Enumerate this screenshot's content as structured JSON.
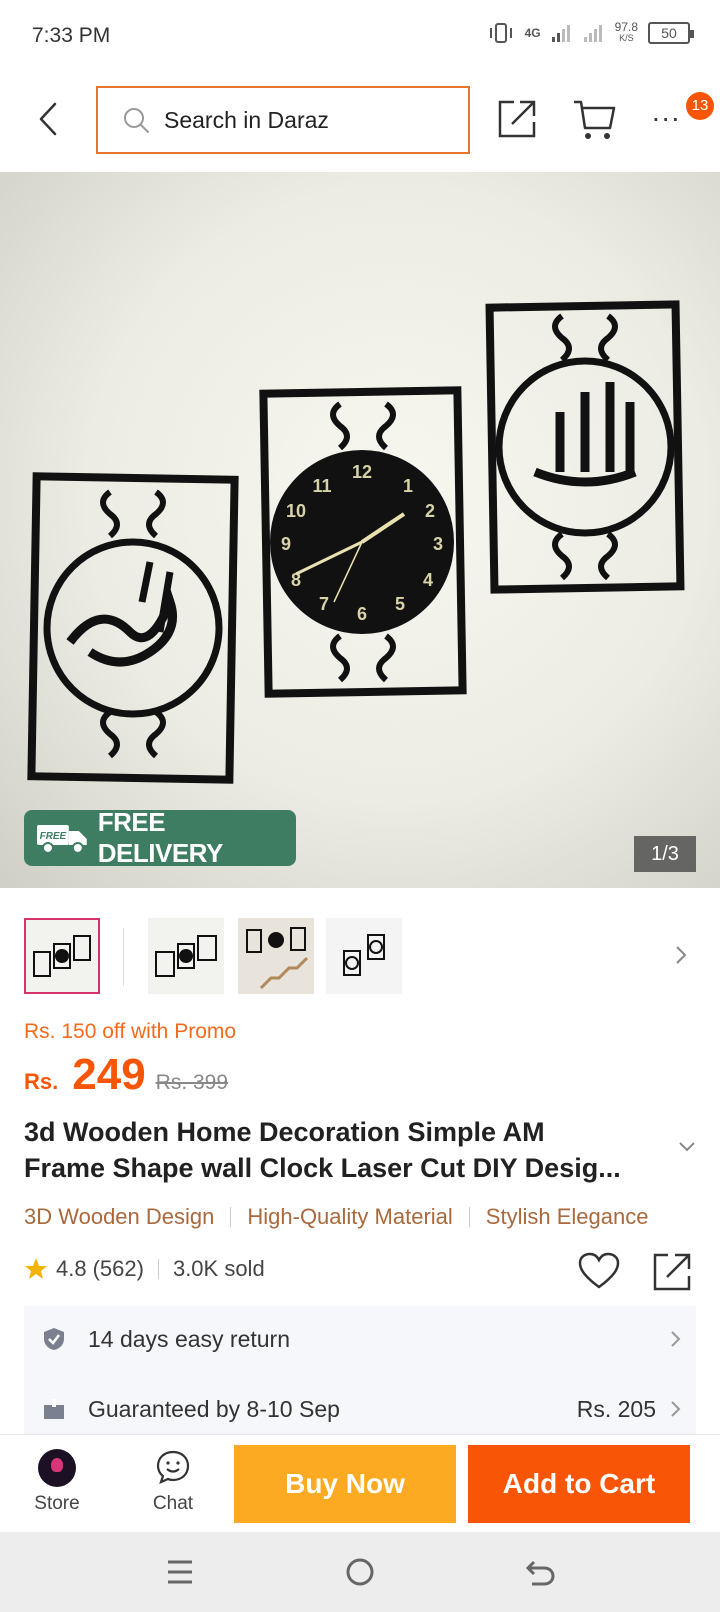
{
  "status_bar": {
    "time": "7:33 PM",
    "network": "4G",
    "speed_value": "97.8",
    "speed_unit": "K/S",
    "battery": "50"
  },
  "top_bar": {
    "search_placeholder": "Search in Daraz",
    "cart_badge": "13",
    "more_label": "..."
  },
  "hero": {
    "delivery_badge_small": "FREE",
    "delivery_badge_text": "FREE DELIVERY",
    "page_indicator": "1/3"
  },
  "product": {
    "promo": "Rs. 150 off with Promo",
    "currency": "Rs.",
    "price": "249",
    "original_price": "Rs. 399",
    "title_line1": "3d Wooden Home Decoration Simple AM",
    "title_line2": "Frame Shape wall Clock Laser Cut DIY Desig...",
    "tags": [
      "3D Wooden Design",
      "High-Quality Material",
      "Stylish Elegance"
    ],
    "rating": "4.8",
    "rating_count": "(562)",
    "sold": "3.0K sold"
  },
  "services": {
    "return_text": "14 days easy return",
    "delivery_text": "Guaranteed by 8-10 Sep",
    "delivery_price": "Rs. 205"
  },
  "bottom_bar": {
    "store_label": "Store",
    "chat_label": "Chat",
    "buy_now_label": "Buy Now",
    "add_to_cart_label": "Add to Cart"
  },
  "colors": {
    "accent": "#f85606",
    "buy_now": "#fcaa21",
    "search_border": "#e6742b",
    "delivery_badge": "#3f7d63",
    "tag_text": "#a9693c",
    "star": "#f5b301"
  },
  "icons": [
    "back-icon",
    "search-icon",
    "share-icon",
    "cart-icon",
    "more-icon",
    "delivery-truck-icon",
    "chevron-right-icon",
    "chevron-down-icon",
    "star-icon",
    "heart-icon",
    "shield-icon",
    "package-icon",
    "chat-icon",
    "menu-icon",
    "home-circle-icon",
    "return-icon"
  ]
}
